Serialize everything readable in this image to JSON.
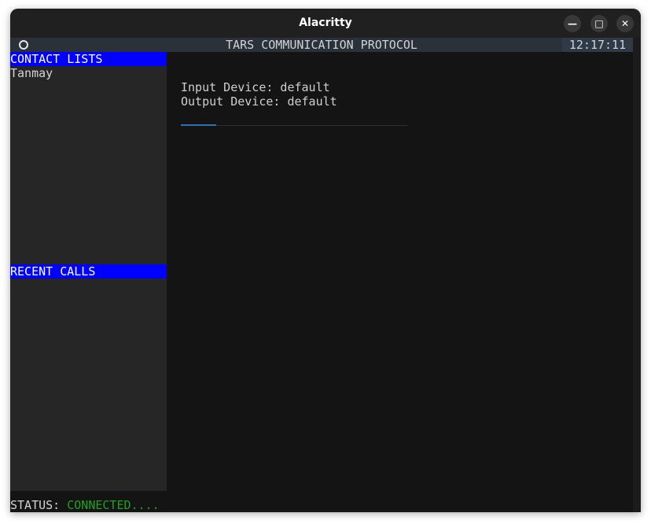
{
  "window": {
    "title": "Alacritty",
    "controls": {
      "minimize_icon": "minimize-icon",
      "maximize_icon": "maximize-icon",
      "close_icon": "close-icon"
    }
  },
  "app": {
    "title": "TARS COMMUNICATION PROTOCOL",
    "clock": "12:17:11"
  },
  "sidebar": {
    "contacts_header": "CONTACT LISTS",
    "contacts": [
      "Tanmay"
    ],
    "recent_header": "RECENT CALLS",
    "recent": []
  },
  "main": {
    "input_device": "Input Device: default",
    "output_device": "Output Device: default"
  },
  "status": {
    "label": "STATUS: ",
    "value": "CONNECTED...."
  },
  "colors": {
    "section_header_bg": "#0000ff",
    "status_connected": "#1fa31f",
    "divider_accent": "#2f6fb3"
  }
}
